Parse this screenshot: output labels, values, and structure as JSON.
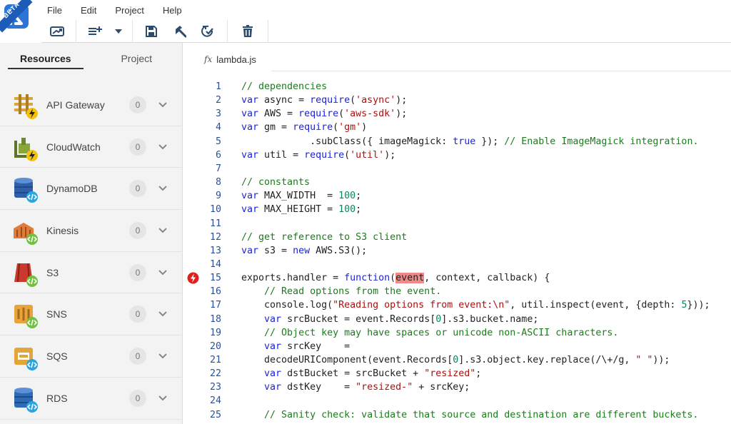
{
  "app": {
    "badge": "BETA"
  },
  "menu": [
    "File",
    "Edit",
    "Project",
    "Help"
  ],
  "toolbar": {
    "buttons": [
      "deploy-icon",
      "add-line-icon",
      "caret-down-icon",
      "save-icon",
      "build-icon",
      "refresh-check-icon",
      "trash-icon"
    ]
  },
  "sidebar": {
    "tabs": [
      "Resources",
      "Project"
    ],
    "active_tab": "Resources",
    "items": [
      {
        "label": "API Gateway",
        "count": "0",
        "icon": "api-gateway-icon",
        "color": "#d9a441",
        "badge": "bolt"
      },
      {
        "label": "CloudWatch",
        "count": "0",
        "icon": "cloudwatch-icon",
        "color": "#8aa63a",
        "badge": "bolt"
      },
      {
        "label": "DynamoDB",
        "count": "0",
        "icon": "dynamodb-icon",
        "color": "#2e5fa8",
        "badge": "code"
      },
      {
        "label": "Kinesis",
        "count": "0",
        "icon": "kinesis-icon",
        "color": "#e07b39",
        "badge": "code-bolt"
      },
      {
        "label": "S3",
        "count": "0",
        "icon": "s3-icon",
        "color": "#c9392d",
        "badge": "code-bolt"
      },
      {
        "label": "SNS",
        "count": "0",
        "icon": "sns-icon",
        "color": "#e8a33a",
        "badge": "code-bolt"
      },
      {
        "label": "SQS",
        "count": "0",
        "icon": "sqs-icon",
        "color": "#e3a43a",
        "badge": "code"
      },
      {
        "label": "RDS",
        "count": "0",
        "icon": "rds-icon",
        "color": "#2e6bb5",
        "badge": "code"
      }
    ]
  },
  "editor": {
    "tab_icon": "fx",
    "filename": "lambda.js",
    "breakpoint_line": 15,
    "lines": [
      [
        [
          "cmt",
          "// dependencies"
        ]
      ],
      [
        [
          "kw",
          "var"
        ],
        [
          "pl",
          " async = "
        ],
        [
          "kw",
          "require"
        ],
        [
          "pl",
          "("
        ],
        [
          "str",
          "'async'"
        ],
        [
          "pl",
          ");"
        ]
      ],
      [
        [
          "kw",
          "var"
        ],
        [
          "pl",
          " AWS = "
        ],
        [
          "kw",
          "require"
        ],
        [
          "pl",
          "("
        ],
        [
          "str",
          "'aws-sdk'"
        ],
        [
          "pl",
          ");"
        ]
      ],
      [
        [
          "kw",
          "var"
        ],
        [
          "pl",
          " gm = "
        ],
        [
          "kw",
          "require"
        ],
        [
          "pl",
          "("
        ],
        [
          "str",
          "'gm'"
        ],
        [
          "pl",
          ")"
        ]
      ],
      [
        [
          "pl",
          "            .subClass({ imageMagick: "
        ],
        [
          "kw",
          "true"
        ],
        [
          "pl",
          " }); "
        ],
        [
          "cmt",
          "// Enable ImageMagick integration."
        ]
      ],
      [
        [
          "kw",
          "var"
        ],
        [
          "pl",
          " util = "
        ],
        [
          "kw",
          "require"
        ],
        [
          "pl",
          "("
        ],
        [
          "str",
          "'util'"
        ],
        [
          "pl",
          ");"
        ]
      ],
      [
        [
          "pl",
          ""
        ]
      ],
      [
        [
          "cmt",
          "// constants"
        ]
      ],
      [
        [
          "kw",
          "var"
        ],
        [
          "pl",
          " MAX_WIDTH  = "
        ],
        [
          "num",
          "100"
        ],
        [
          "pl",
          ";"
        ]
      ],
      [
        [
          "kw",
          "var"
        ],
        [
          "pl",
          " MAX_HEIGHT = "
        ],
        [
          "num",
          "100"
        ],
        [
          "pl",
          ";"
        ]
      ],
      [
        [
          "pl",
          ""
        ]
      ],
      [
        [
          "cmt",
          "// get reference to S3 client"
        ]
      ],
      [
        [
          "kw",
          "var"
        ],
        [
          "pl",
          " s3 = "
        ],
        [
          "kw",
          "new"
        ],
        [
          "pl",
          " AWS.S3();"
        ]
      ],
      [
        [
          "pl",
          ""
        ]
      ],
      [
        [
          "pl",
          "exports.handler = "
        ],
        [
          "kw",
          "function"
        ],
        [
          "pl",
          "("
        ],
        [
          "hl",
          "event"
        ],
        [
          "pl",
          ", context, callback) {"
        ]
      ],
      [
        [
          "pl",
          "    "
        ],
        [
          "cmt",
          "// Read options from the event."
        ]
      ],
      [
        [
          "pl",
          "    console.log("
        ],
        [
          "str",
          "\"Reading options from event:\\n\""
        ],
        [
          "pl",
          ", util.inspect(event, {depth: "
        ],
        [
          "num",
          "5"
        ],
        [
          "pl",
          "}));"
        ]
      ],
      [
        [
          "pl",
          "    "
        ],
        [
          "kw",
          "var"
        ],
        [
          "pl",
          " srcBucket = event.Records["
        ],
        [
          "num",
          "0"
        ],
        [
          "pl",
          "].s3.bucket.name;"
        ]
      ],
      [
        [
          "pl",
          "    "
        ],
        [
          "cmt",
          "// Object key may have spaces or unicode non-ASCII characters."
        ]
      ],
      [
        [
          "pl",
          "    "
        ],
        [
          "kw",
          "var"
        ],
        [
          "pl",
          " srcKey    ="
        ]
      ],
      [
        [
          "pl",
          "    decodeURIComponent(event.Records["
        ],
        [
          "num",
          "0"
        ],
        [
          "pl",
          "].s3.object.key.replace(/\\+/g, "
        ],
        [
          "str",
          "\" \""
        ],
        [
          "pl",
          "));"
        ]
      ],
      [
        [
          "pl",
          "    "
        ],
        [
          "kw",
          "var"
        ],
        [
          "pl",
          " dstBucket = srcBucket + "
        ],
        [
          "str",
          "\"resized\""
        ],
        [
          "pl",
          ";"
        ]
      ],
      [
        [
          "pl",
          "    "
        ],
        [
          "kw",
          "var"
        ],
        [
          "pl",
          " dstKey    = "
        ],
        [
          "str",
          "\"resized-\""
        ],
        [
          "pl",
          " + srcKey;"
        ]
      ],
      [
        [
          "pl",
          ""
        ]
      ],
      [
        [
          "pl",
          "    "
        ],
        [
          "cmt",
          "// Sanity check: validate that source and destination are different buckets."
        ]
      ]
    ]
  }
}
